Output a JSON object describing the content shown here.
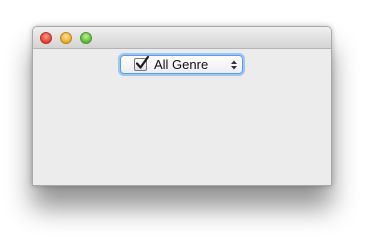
{
  "window": {
    "title": ""
  },
  "popup": {
    "selected": "All Genre",
    "checked": true
  },
  "icons": {
    "close": "close-button-icon",
    "minimize": "minimize-button-icon",
    "zoom": "zoom-button-icon",
    "checkmark": "checkmark-icon",
    "updown": "up-down-arrows-icon"
  },
  "colors": {
    "window_bg": "#ececec",
    "focus_ring": "#9cc7f3",
    "close": "#ee4d3d",
    "minimize": "#f3b738",
    "zoom": "#6cc444"
  }
}
